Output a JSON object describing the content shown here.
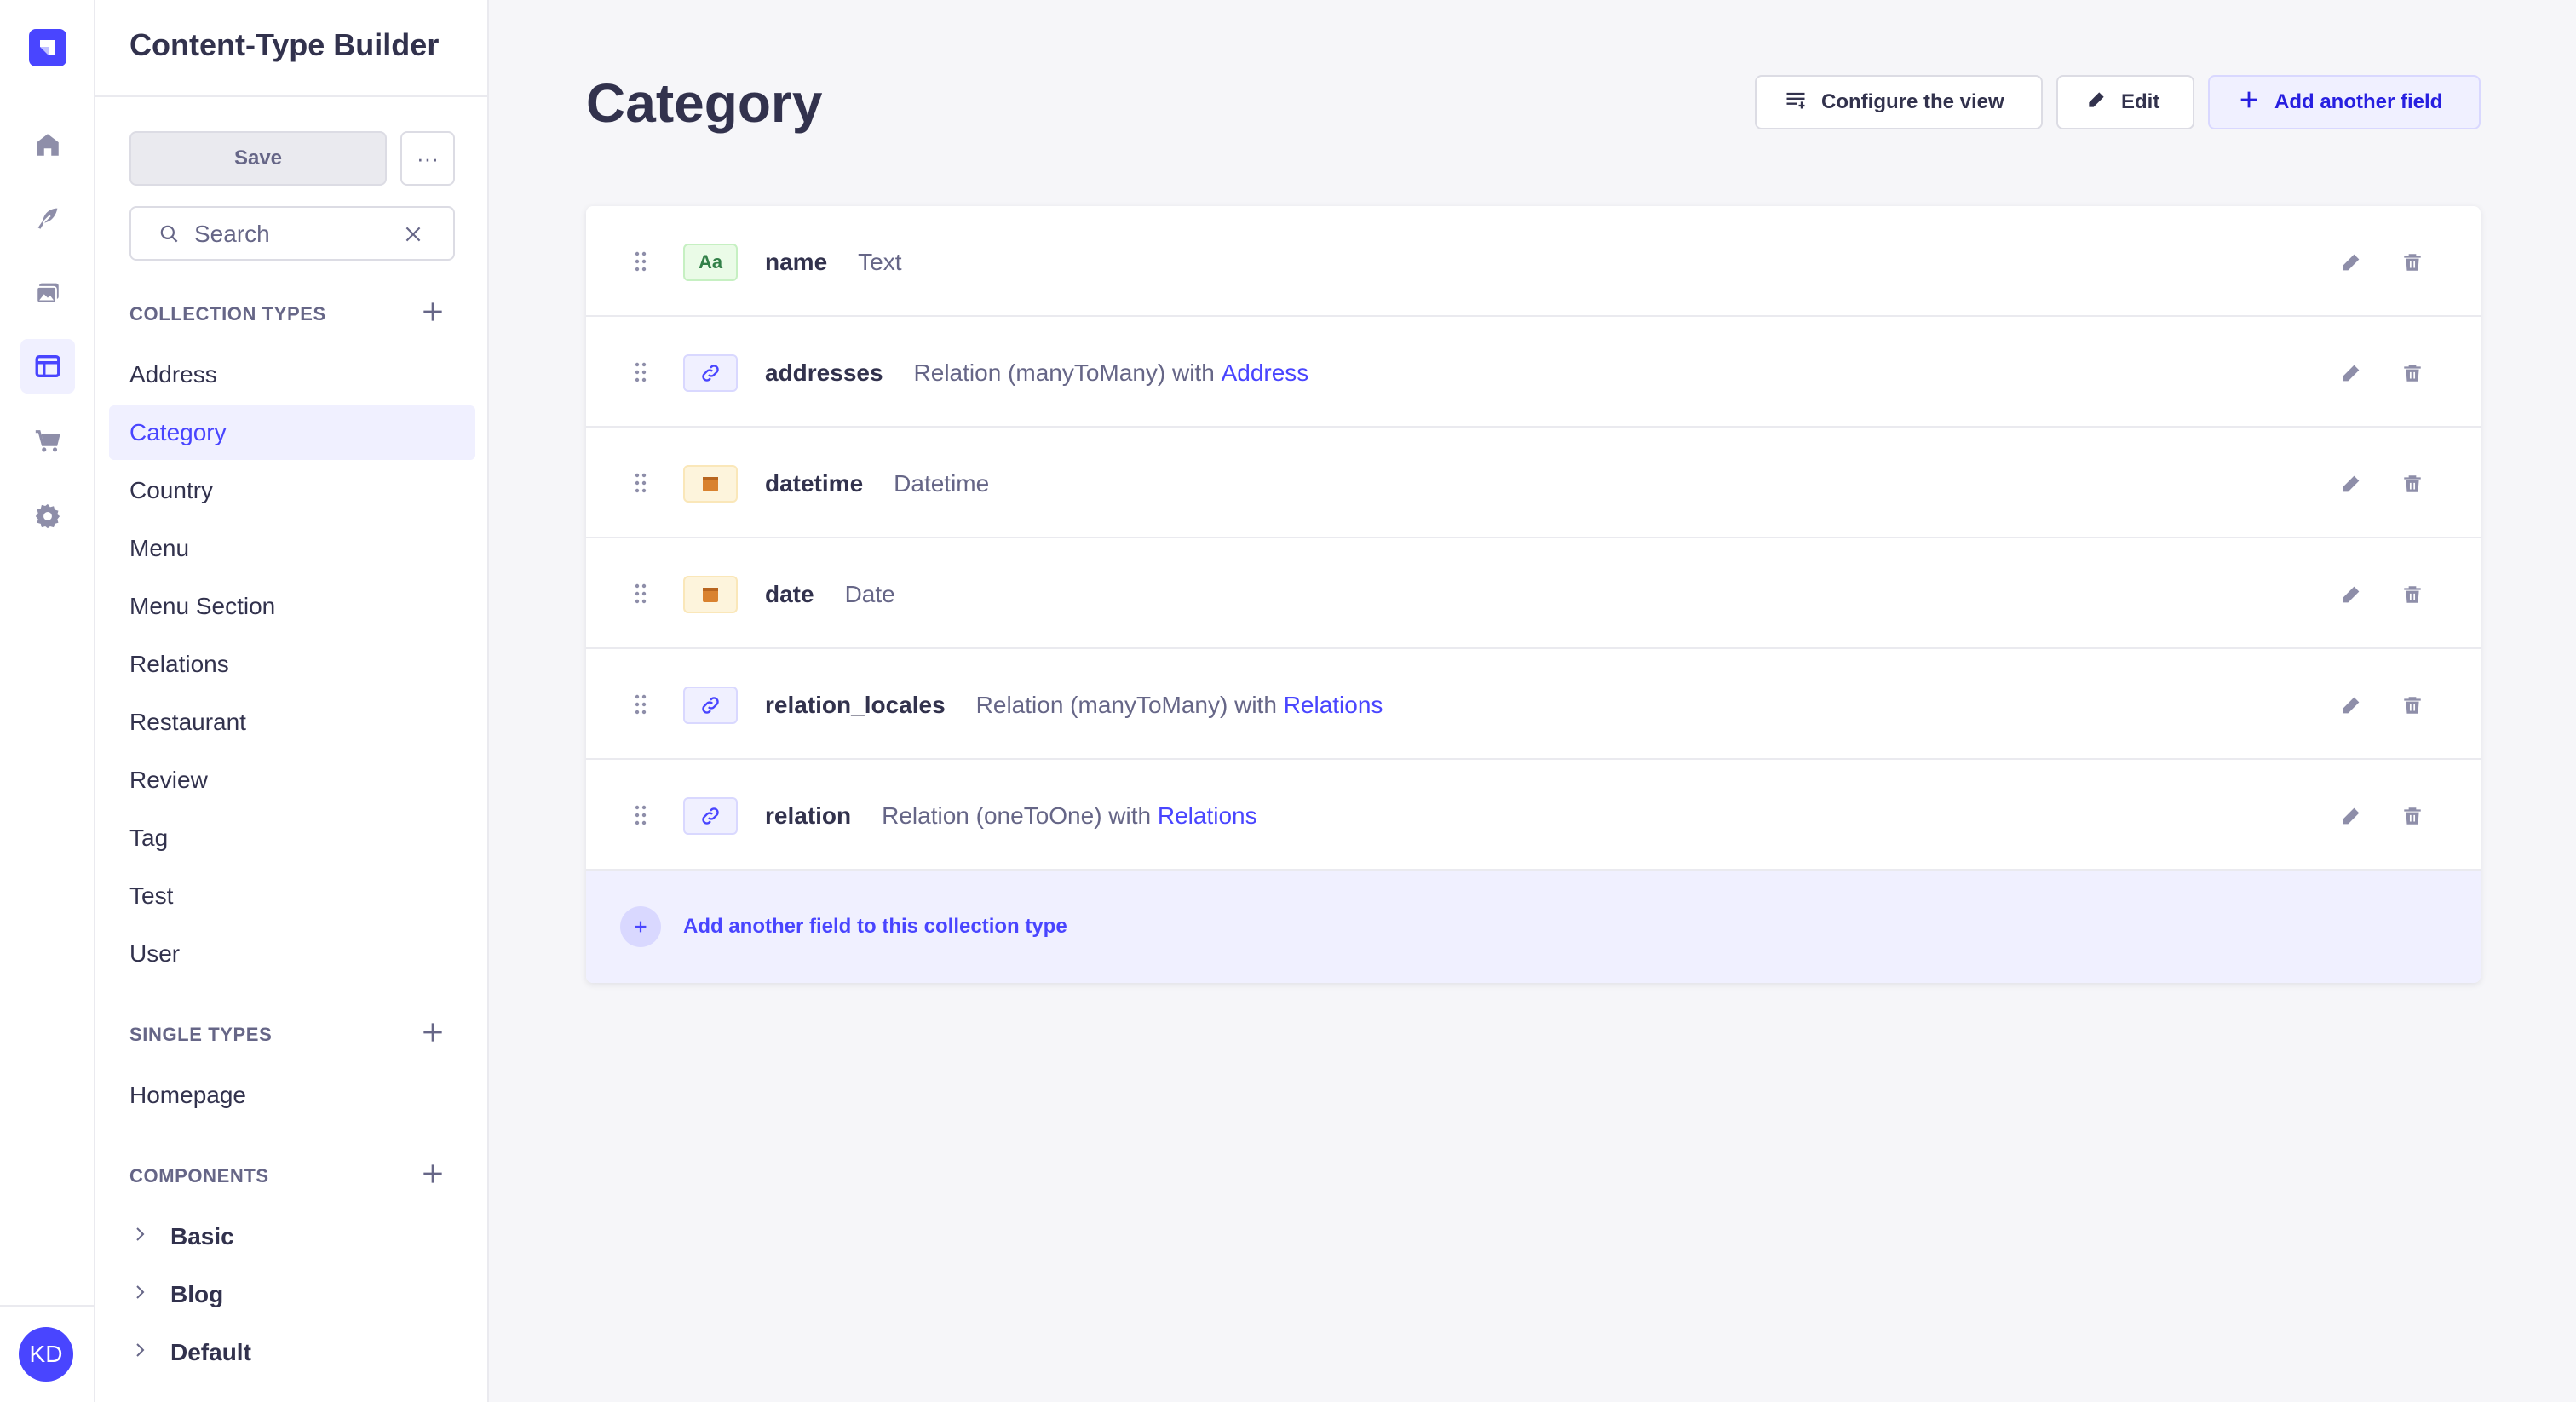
{
  "app": {
    "logo_icon": "strapi-logo-icon",
    "nav_icons": [
      "home-icon",
      "feather-icon",
      "media-library-icon",
      "layout-icon",
      "cart-icon",
      "gear-icon"
    ],
    "user_initials": "KD",
    "accent_color": "#4945ff"
  },
  "sidebar": {
    "title": "Content-Type Builder",
    "save_label": "Save",
    "more_label": "···",
    "search": {
      "placeholder": "Search",
      "value": ""
    },
    "collection_types": {
      "heading": "COLLECTION TYPES",
      "items": [
        "Address",
        "Category",
        "Country",
        "Menu",
        "Menu Section",
        "Relations",
        "Restaurant",
        "Review",
        "Tag",
        "Test",
        "User"
      ],
      "active": "Category"
    },
    "single_types": {
      "heading": "SINGLE TYPES",
      "items": [
        "Homepage"
      ]
    },
    "components": {
      "heading": "COMPONENTS",
      "items": [
        "Basic",
        "Blog",
        "Default"
      ]
    }
  },
  "main": {
    "title": "Category",
    "buttons": {
      "configure": "Configure the view",
      "edit": "Edit",
      "add_field": "Add another field"
    },
    "fields": [
      {
        "name": "name",
        "type": "Text",
        "target": "",
        "icon": "text-icon",
        "kind": "text",
        "icon_label": "Aa"
      },
      {
        "name": "addresses",
        "type": "Relation (manyToMany) with",
        "target": "Address",
        "icon": "relation-icon",
        "kind": "rel",
        "icon_label": ""
      },
      {
        "name": "datetime",
        "type": "Datetime",
        "target": "",
        "icon": "calendar-icon",
        "kind": "date",
        "icon_label": ""
      },
      {
        "name": "date",
        "type": "Date",
        "target": "",
        "icon": "calendar-icon",
        "kind": "date",
        "icon_label": ""
      },
      {
        "name": "relation_locales",
        "type": "Relation (manyToMany) with",
        "target": "Relations",
        "icon": "relation-icon",
        "kind": "rel",
        "icon_label": ""
      },
      {
        "name": "relation",
        "type": "Relation (oneToOne) with",
        "target": "Relations",
        "icon": "relation-icon",
        "kind": "rel",
        "icon_label": ""
      }
    ],
    "add_field_row": "Add another field to this collection type"
  }
}
